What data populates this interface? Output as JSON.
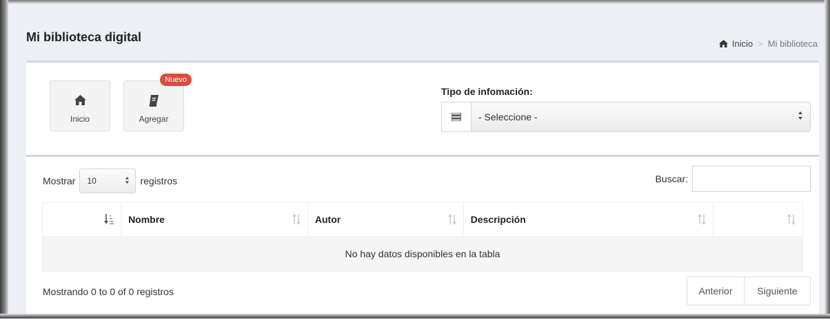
{
  "header": {
    "title": "Mi biblioteca digital",
    "breadcrumb": {
      "home_label": "Inicio",
      "separator": ">",
      "current": "Mi biblioteca"
    }
  },
  "toolbar": {
    "home_button_label": "Inicio",
    "add_button_label": "Agregar",
    "add_badge": "Nuevo"
  },
  "filter": {
    "label": "Tipo de infomación:",
    "select_value": "- Seleccione -"
  },
  "table_controls": {
    "show_label": "Mostrar",
    "page_length": "10",
    "records_label": "registros",
    "search_label": "Buscar:",
    "search_value": ""
  },
  "table": {
    "columns": [
      "",
      "Nombre",
      "Autor",
      "Descripción",
      ""
    ],
    "empty_message": "No hay datos disponibles en la tabla"
  },
  "footer": {
    "info": "Mostrando 0 to 0 of 0 registros",
    "prev_label": "Anterior",
    "next_label": "Siguiente"
  },
  "colors": {
    "badge": "#dd4b39",
    "page_background": "#ecf0f5",
    "box_border": "#d2d6de"
  },
  "icons": {
    "breadcrumb_home": "home-icon",
    "home_button": "home-icon",
    "add_button": "book-icon",
    "filter_addon": "list-icon",
    "sort_first_column": "sort-amount-asc-icon",
    "sort_other_columns": "sort-icon"
  }
}
